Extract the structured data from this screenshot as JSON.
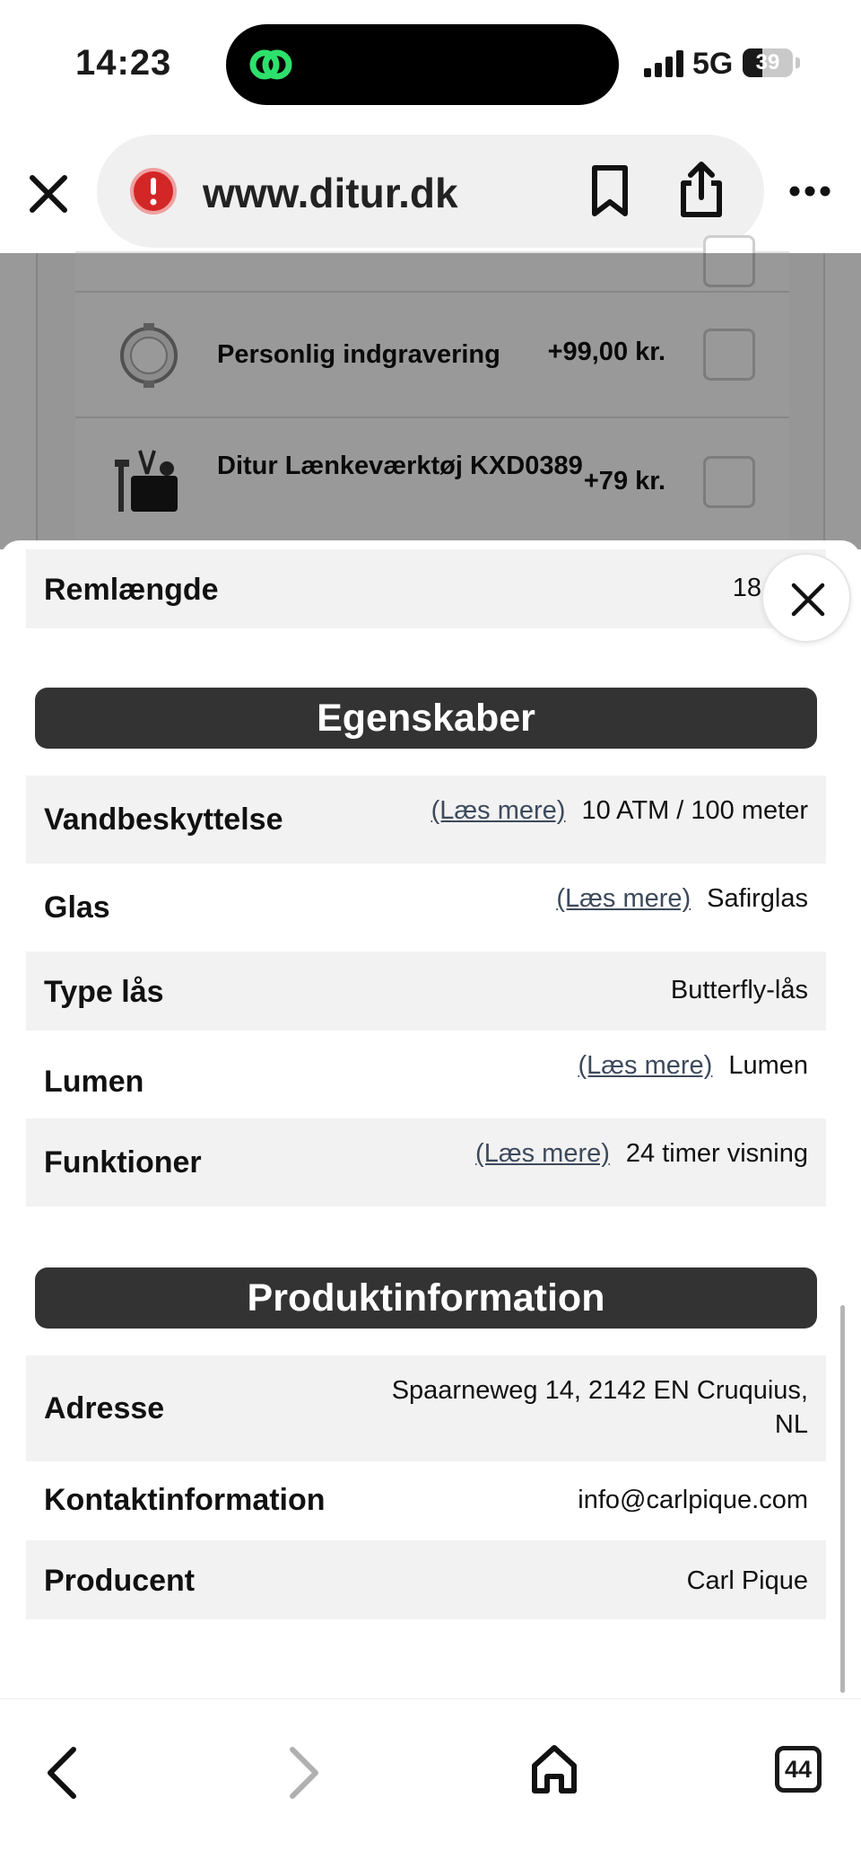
{
  "status_bar": {
    "time": "14:23",
    "network": "5G",
    "battery": "39",
    "battery_fraction": 0.39,
    "island_icon": "green-link-icon"
  },
  "browser": {
    "url": "www.ditur.dk",
    "icons": [
      "close-icon",
      "warning-icon",
      "bookmark-icon",
      "share-icon",
      "more-icon"
    ]
  },
  "background_page": {
    "items": [
      {
        "name": "Personlig indgravering",
        "price": "+99,00 kr."
      },
      {
        "name": "Ditur Lænkeværktøj KXD0389",
        "price": "+79 kr."
      }
    ]
  },
  "sheet": {
    "top_row": {
      "label": "Remlængde",
      "value": "18"
    },
    "sections": [
      {
        "title": "Egenskaber",
        "rows": [
          {
            "label": "Vandbeskyttelse",
            "link": "(Læs mere)",
            "value": "10 ATM / 100 meter"
          },
          {
            "label": "Glas",
            "link": "(Læs mere)",
            "value": "Safirglas"
          },
          {
            "label": "Type lås",
            "link": "",
            "value": "Butterfly-lås"
          },
          {
            "label": "Lumen",
            "link": "(Læs mere)",
            "value": "Lumen"
          },
          {
            "label": "Funktioner",
            "link": "(Læs mere)",
            "value": "24 timer visning"
          }
        ]
      },
      {
        "title": "Produktinformation",
        "rows": [
          {
            "label": "Adresse",
            "value_line1": "Spaarneweg 14, 2142 EN Cruquius,",
            "value_line2": "NL"
          },
          {
            "label": "Kontaktinformation",
            "value": "info@carlpique.com"
          },
          {
            "label": "Producent",
            "value": "Carl Pique"
          }
        ]
      }
    ]
  },
  "bottom_nav": {
    "tab_count": "44",
    "icons": [
      "back-icon",
      "forward-icon",
      "home-icon",
      "tabs-icon"
    ]
  }
}
